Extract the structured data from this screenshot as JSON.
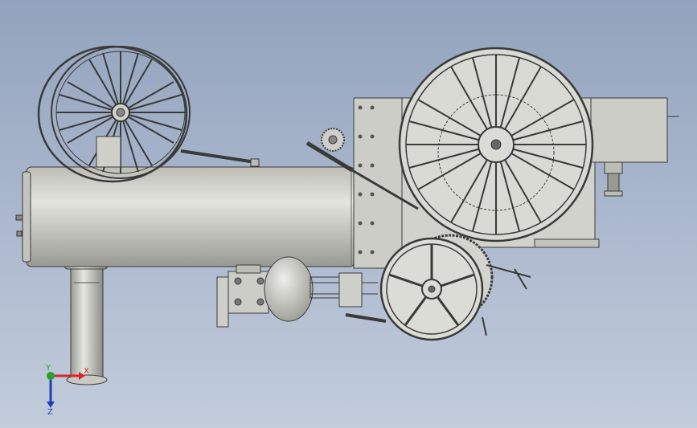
{
  "viewport": {
    "background_top": "#93a3bd",
    "background_bottom": "#c2ccdb",
    "part_fill": "#d2d2cc",
    "part_stroke": "#3a3a3a"
  },
  "triad": {
    "x_label": "X",
    "y_label": "Y",
    "z_label": "Z",
    "x_color": "#d8262a",
    "y_color": "#2ca02c",
    "z_color": "#1f3fbf"
  }
}
